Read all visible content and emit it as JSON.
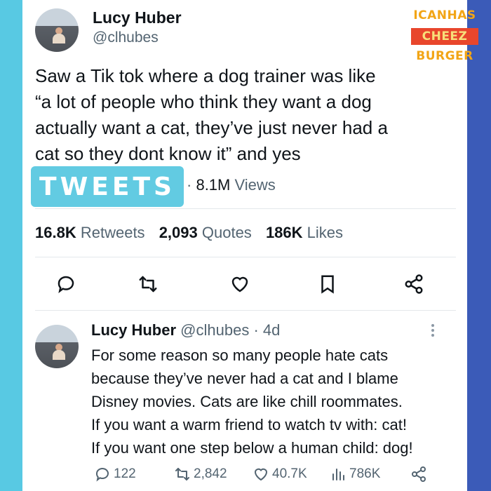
{
  "watermark": {
    "line1": "ICANHAS",
    "line2": "CHEEZ",
    "line3": "BURGER"
  },
  "main_tweet": {
    "author_name": "Lucy Huber",
    "author_handle": "@clhubes",
    "text": "Saw a Tik tok where a dog trainer was like\n“a lot of people who think they want a dog\nactually want a cat, they’ve just never had a\ncat so they dont know it” and yes",
    "overlay_label": "TWEETS",
    "views_count": "8.1M",
    "views_label": "Views",
    "stats": {
      "retweets_count": "16.8K",
      "retweets_label": "Retweets",
      "quotes_count": "2,093",
      "quotes_label": "Quotes",
      "likes_count": "186K",
      "likes_label": "Likes"
    },
    "actions": [
      "reply-icon",
      "retweet-icon",
      "like-icon",
      "bookmark-icon",
      "share-icon"
    ]
  },
  "reply_tweet": {
    "author_name": "Lucy Huber",
    "author_handle": "@clhubes",
    "time": "· 4d",
    "text": "For some reason so many people hate cats\nbecause they’ve never had a cat and I blame\nDisney movies. Cats are like chill roommates.\nIf you want a warm friend to watch tv with: cat!\nIf you want one step below a human child: dog!",
    "replies": "122",
    "retweets": "2,842",
    "likes": "40.7K",
    "views": "786K"
  },
  "colors": {
    "text": "#0f1419",
    "muted": "#536471",
    "overlay": "#62cbe2",
    "left_edge": "#58c9e3",
    "right_edge": "#3b5bb8"
  }
}
